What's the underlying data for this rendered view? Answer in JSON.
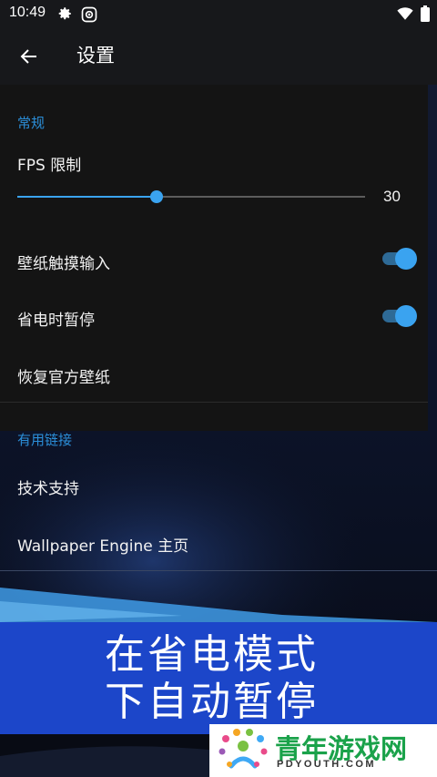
{
  "status_bar": {
    "time": "10:49",
    "icons": [
      "gear-icon",
      "screen-record-icon",
      "wifi-icon",
      "battery-icon"
    ]
  },
  "app_bar": {
    "back_icon": "arrow-left-icon",
    "title": "设置"
  },
  "sections": {
    "general": {
      "header": "常规",
      "fps_label": "FPS 限制",
      "fps_value": "30",
      "fps_fraction": 0.4,
      "touch_input_label": "壁纸触摸输入",
      "touch_input_on": true,
      "battery_pause_label": "省电时暂停",
      "battery_pause_on": true,
      "restore_label": "恢复官方壁纸"
    },
    "links": {
      "header": "有用链接",
      "support_label": "技术支持",
      "homepage_label": "Wallpaper Engine 主页"
    }
  },
  "banner": {
    "line1": "在省电模式",
    "line2": "下自动暂停"
  },
  "watermark": {
    "name": "青年游戏网",
    "domain": "PDYOUTH.COM"
  },
  "colors": {
    "accent": "#3aa3f0",
    "section_header": "#2b8ed8",
    "banner": "#1c46c9"
  }
}
